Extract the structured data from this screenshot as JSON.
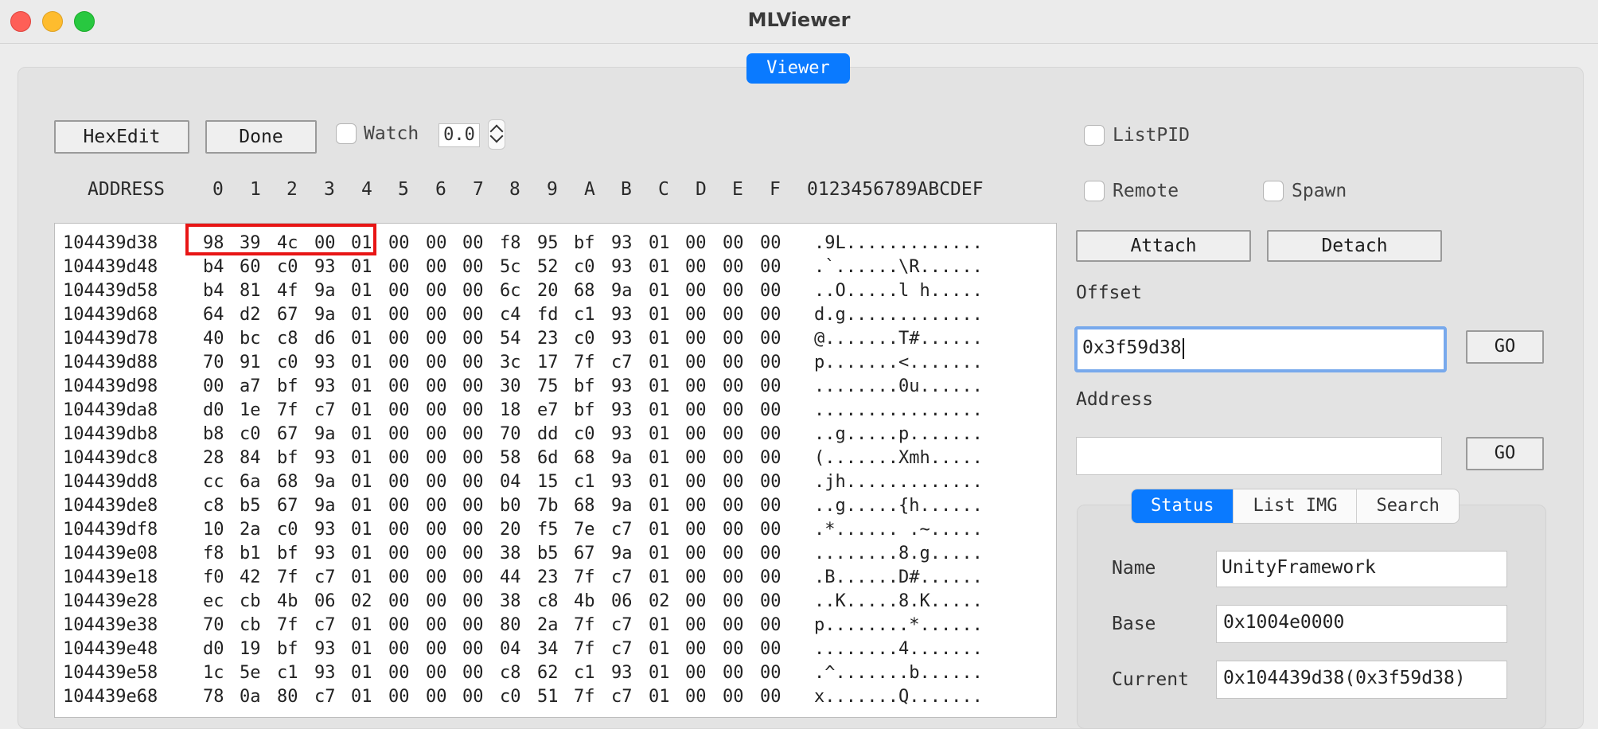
{
  "window": {
    "title": "MLViewer"
  },
  "tabs": {
    "viewer": "Viewer"
  },
  "toolbar": {
    "hexedit": "HexEdit",
    "done": "Done",
    "watch_label": "Watch",
    "watch_value": "0.0",
    "listpid_label": "ListPID",
    "remote_label": "Remote",
    "spawn_label": "Spawn"
  },
  "hex_header": {
    "address": "ADDRESS",
    "columns": [
      "0",
      "1",
      "2",
      "3",
      "4",
      "5",
      "6",
      "7",
      "8",
      "9",
      "A",
      "B",
      "C",
      "D",
      "E",
      "F"
    ],
    "ascii": "0123456789ABCDEF"
  },
  "hex_rows": [
    {
      "addr": "104439d38",
      "bytes": [
        "98",
        "39",
        "4c",
        "00",
        "01",
        "00",
        "00",
        "00",
        "f8",
        "95",
        "bf",
        "93",
        "01",
        "00",
        "00",
        "00"
      ],
      "ascii": ".9L............."
    },
    {
      "addr": "104439d48",
      "bytes": [
        "b4",
        "60",
        "c0",
        "93",
        "01",
        "00",
        "00",
        "00",
        "5c",
        "52",
        "c0",
        "93",
        "01",
        "00",
        "00",
        "00"
      ],
      "ascii": ".`......\\R......"
    },
    {
      "addr": "104439d58",
      "bytes": [
        "b4",
        "81",
        "4f",
        "9a",
        "01",
        "00",
        "00",
        "00",
        "6c",
        "20",
        "68",
        "9a",
        "01",
        "00",
        "00",
        "00"
      ],
      "ascii": "..O.....l h....."
    },
    {
      "addr": "104439d68",
      "bytes": [
        "64",
        "d2",
        "67",
        "9a",
        "01",
        "00",
        "00",
        "00",
        "c4",
        "fd",
        "c1",
        "93",
        "01",
        "00",
        "00",
        "00"
      ],
      "ascii": "d.g............."
    },
    {
      "addr": "104439d78",
      "bytes": [
        "40",
        "bc",
        "c8",
        "d6",
        "01",
        "00",
        "00",
        "00",
        "54",
        "23",
        "c0",
        "93",
        "01",
        "00",
        "00",
        "00"
      ],
      "ascii": "@.......T#......"
    },
    {
      "addr": "104439d88",
      "bytes": [
        "70",
        "91",
        "c0",
        "93",
        "01",
        "00",
        "00",
        "00",
        "3c",
        "17",
        "7f",
        "c7",
        "01",
        "00",
        "00",
        "00"
      ],
      "ascii": "p.......<......."
    },
    {
      "addr": "104439d98",
      "bytes": [
        "00",
        "a7",
        "bf",
        "93",
        "01",
        "00",
        "00",
        "00",
        "30",
        "75",
        "bf",
        "93",
        "01",
        "00",
        "00",
        "00"
      ],
      "ascii": "........0u......"
    },
    {
      "addr": "104439da8",
      "bytes": [
        "d0",
        "1e",
        "7f",
        "c7",
        "01",
        "00",
        "00",
        "00",
        "18",
        "e7",
        "bf",
        "93",
        "01",
        "00",
        "00",
        "00"
      ],
      "ascii": "................"
    },
    {
      "addr": "104439db8",
      "bytes": [
        "b8",
        "c0",
        "67",
        "9a",
        "01",
        "00",
        "00",
        "00",
        "70",
        "dd",
        "c0",
        "93",
        "01",
        "00",
        "00",
        "00"
      ],
      "ascii": "..g.....p......."
    },
    {
      "addr": "104439dc8",
      "bytes": [
        "28",
        "84",
        "bf",
        "93",
        "01",
        "00",
        "00",
        "00",
        "58",
        "6d",
        "68",
        "9a",
        "01",
        "00",
        "00",
        "00"
      ],
      "ascii": "(.......Xmh....."
    },
    {
      "addr": "104439dd8",
      "bytes": [
        "cc",
        "6a",
        "68",
        "9a",
        "01",
        "00",
        "00",
        "00",
        "04",
        "15",
        "c1",
        "93",
        "01",
        "00",
        "00",
        "00"
      ],
      "ascii": ".jh............."
    },
    {
      "addr": "104439de8",
      "bytes": [
        "c8",
        "b5",
        "67",
        "9a",
        "01",
        "00",
        "00",
        "00",
        "b0",
        "7b",
        "68",
        "9a",
        "01",
        "00",
        "00",
        "00"
      ],
      "ascii": "..g.....{h......"
    },
    {
      "addr": "104439df8",
      "bytes": [
        "10",
        "2a",
        "c0",
        "93",
        "01",
        "00",
        "00",
        "00",
        "20",
        "f5",
        "7e",
        "c7",
        "01",
        "00",
        "00",
        "00"
      ],
      "ascii": ".*...... .~....."
    },
    {
      "addr": "104439e08",
      "bytes": [
        "f8",
        "b1",
        "bf",
        "93",
        "01",
        "00",
        "00",
        "00",
        "38",
        "b5",
        "67",
        "9a",
        "01",
        "00",
        "00",
        "00"
      ],
      "ascii": "........8.g....."
    },
    {
      "addr": "104439e18",
      "bytes": [
        "f0",
        "42",
        "7f",
        "c7",
        "01",
        "00",
        "00",
        "00",
        "44",
        "23",
        "7f",
        "c7",
        "01",
        "00",
        "00",
        "00"
      ],
      "ascii": ".B......D#......"
    },
    {
      "addr": "104439e28",
      "bytes": [
        "ec",
        "cb",
        "4b",
        "06",
        "02",
        "00",
        "00",
        "00",
        "38",
        "c8",
        "4b",
        "06",
        "02",
        "00",
        "00",
        "00"
      ],
      "ascii": "..K.....8.K....."
    },
    {
      "addr": "104439e38",
      "bytes": [
        "70",
        "cb",
        "7f",
        "c7",
        "01",
        "00",
        "00",
        "00",
        "80",
        "2a",
        "7f",
        "c7",
        "01",
        "00",
        "00",
        "00"
      ],
      "ascii": "p........*......"
    },
    {
      "addr": "104439e48",
      "bytes": [
        "d0",
        "19",
        "bf",
        "93",
        "01",
        "00",
        "00",
        "00",
        "04",
        "34",
        "7f",
        "c7",
        "01",
        "00",
        "00",
        "00"
      ],
      "ascii": "........4......."
    },
    {
      "addr": "104439e58",
      "bytes": [
        "1c",
        "5e",
        "c1",
        "93",
        "01",
        "00",
        "00",
        "00",
        "c8",
        "62",
        "c1",
        "93",
        "01",
        "00",
        "00",
        "00"
      ],
      "ascii": ".^.......b......"
    },
    {
      "addr": "104439e68",
      "bytes": [
        "78",
        "0a",
        "80",
        "c7",
        "01",
        "00",
        "00",
        "00",
        "c0",
        "51",
        "7f",
        "c7",
        "01",
        "00",
        "00",
        "00"
      ],
      "ascii": "x.......Q......."
    }
  ],
  "right": {
    "attach": "Attach",
    "detach": "Detach",
    "offset_label": "Offset",
    "offset_value": "0x3f59d38",
    "go": "GO",
    "address_label": "Address",
    "address_value": "",
    "segments": [
      "Status",
      "List IMG",
      "Search"
    ],
    "name_label": "Name",
    "name_value": "UnityFramework",
    "base_label": "Base",
    "base_value": "0x1004e0000",
    "current_label": "Current",
    "current_value": "0x104439d38(0x3f59d38)"
  }
}
